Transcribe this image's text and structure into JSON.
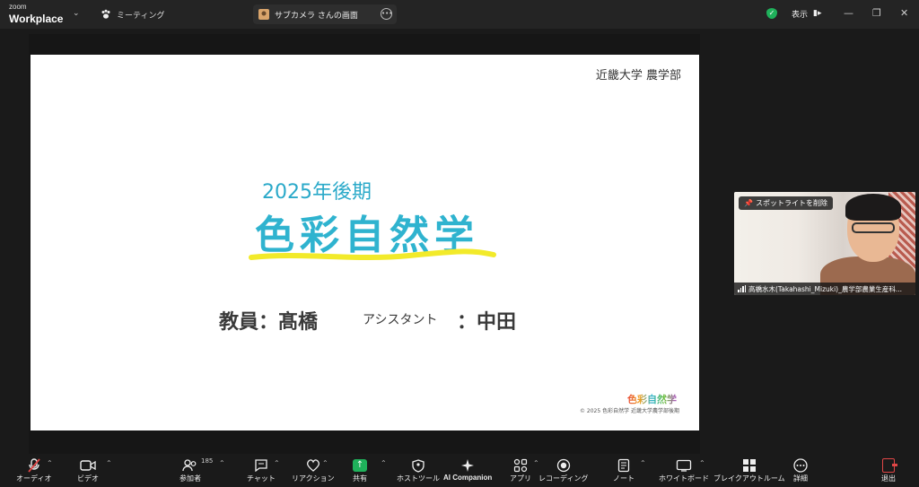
{
  "app": {
    "logo_small": "zoom",
    "logo_big": "Workplace",
    "meeting_tab": "ミーティング",
    "share_tab": "サブカメラ さんの画面",
    "view_label": "表示"
  },
  "slide": {
    "university": "近畿大学 農学部",
    "term": "2025年後期",
    "course": "色彩自然学",
    "teacher": "教員：髙橋",
    "assistant_label": "アシスタント",
    "assistant_name": "：中田",
    "brand": "色彩自然学",
    "copyright": "© 2025 色彩自然学 近畿大学農学部後期"
  },
  "video": {
    "spotlight_button": "スポットライトを削除",
    "participant_name": "高橋水木(Takahashi_Mizuki)_農学部農業生産科..."
  },
  "toolbar": {
    "audio": "オーディオ",
    "video": "ビデオ",
    "participants": "参加者",
    "participants_count": "185",
    "chat": "チャット",
    "reactions": "リアクション",
    "share": "共有",
    "host_tools": "ホストツール",
    "ai_companion": "AI Companion",
    "apps": "アプリ",
    "recording": "レコーディング",
    "notes": "ノート",
    "whiteboard": "ホワイトボード",
    "breakout": "ブレイクアウトルーム",
    "more": "詳細",
    "leave": "退出"
  },
  "colors": {
    "accent_green": "#1fb15b",
    "slide_title": "#2fb3cf",
    "underline_yellow": "#f2ea2a",
    "leave_red": "#e04646"
  }
}
